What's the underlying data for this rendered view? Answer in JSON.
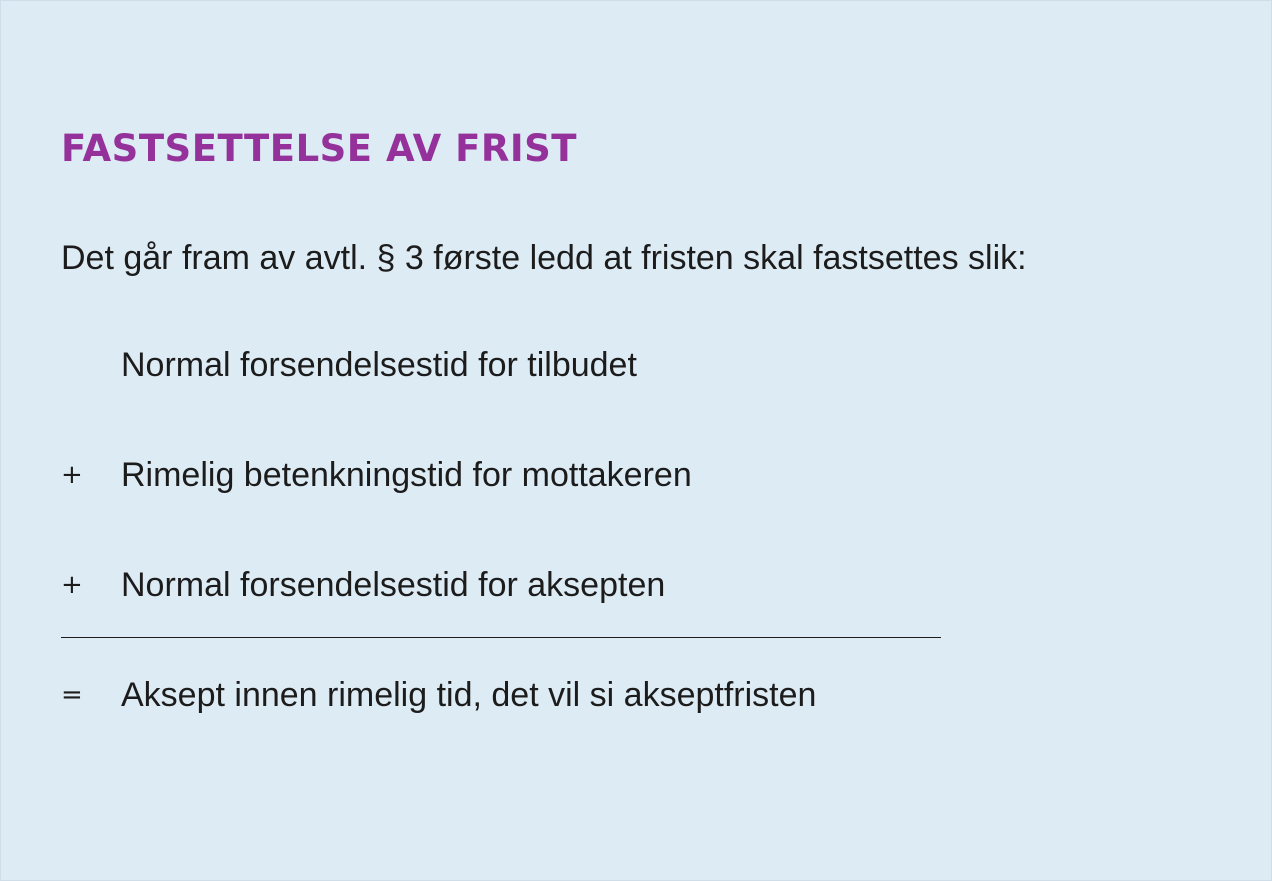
{
  "colors": {
    "background": "#ddebf4",
    "heading": "#94319a",
    "text": "#1c1c1c"
  },
  "heading": "FASTSETTELSE AV FRIST",
  "intro": "Det går fram av avtl. § 3 første ledd at fristen skal fastsettes slik:",
  "calculation": {
    "rows": [
      {
        "operator": "",
        "text": "Normal forsendelsestid for tilbudet"
      },
      {
        "operator": "+",
        "text": "Rimelig betenkningstid for mottakeren"
      },
      {
        "operator": "+",
        "text": "Normal forsendelsestid for aksepten"
      }
    ],
    "result": {
      "operator": "=",
      "text": "Aksept innen rimelig tid, det vil si akseptfristen"
    }
  }
}
